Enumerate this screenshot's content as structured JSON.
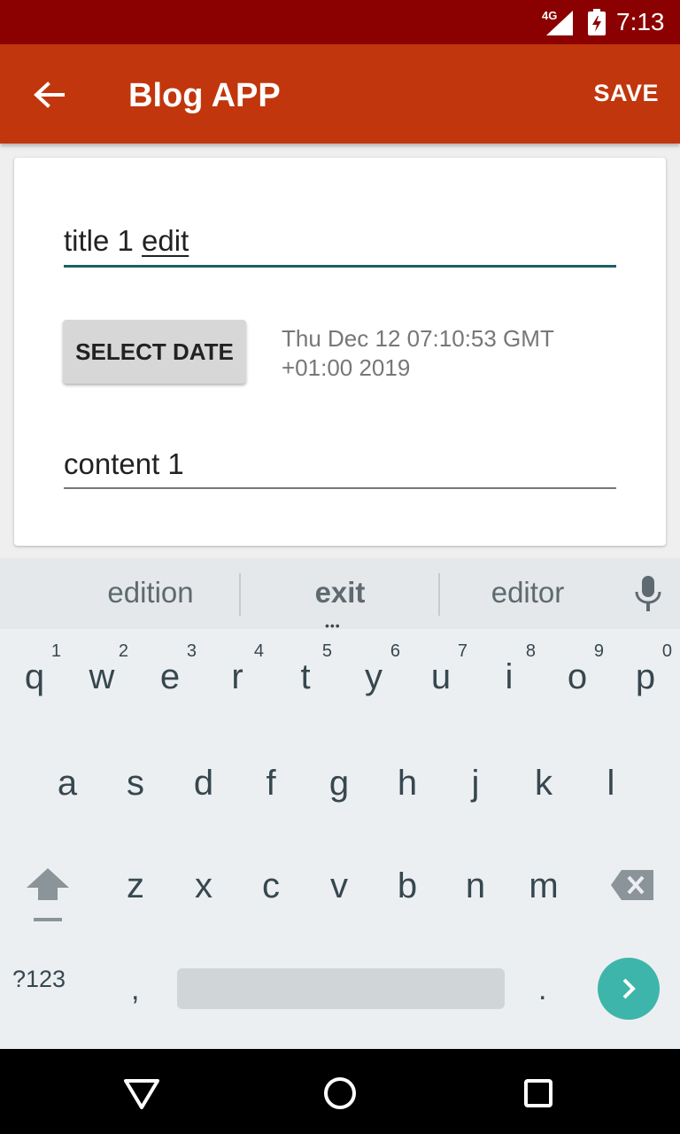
{
  "status_bar": {
    "network": "4G",
    "time": "7:13",
    "icons": [
      "signal-icon",
      "battery-charging-icon"
    ]
  },
  "toolbar": {
    "back_icon": "arrow-left-icon",
    "title": "Blog APP",
    "save_label": "SAVE"
  },
  "form": {
    "title_value_plain": "title 1 ",
    "title_value_composing": "edit",
    "select_date_label": "SELECT DATE",
    "date_line1": "Thu Dec 12 07:10:53 GMT",
    "date_line2": "+01:00 2019",
    "content_value": "content 1"
  },
  "keyboard": {
    "suggestions": [
      "edition",
      "exit",
      "editor"
    ],
    "mic_icon": "microphone-icon",
    "row1": [
      {
        "key": "q",
        "hint": "1"
      },
      {
        "key": "w",
        "hint": "2"
      },
      {
        "key": "e",
        "hint": "3"
      },
      {
        "key": "r",
        "hint": "4"
      },
      {
        "key": "t",
        "hint": "5"
      },
      {
        "key": "y",
        "hint": "6"
      },
      {
        "key": "u",
        "hint": "7"
      },
      {
        "key": "i",
        "hint": "8"
      },
      {
        "key": "o",
        "hint": "9"
      },
      {
        "key": "p",
        "hint": "0"
      }
    ],
    "row2": [
      "a",
      "s",
      "d",
      "f",
      "g",
      "h",
      "j",
      "k",
      "l"
    ],
    "row3": [
      "z",
      "x",
      "c",
      "v",
      "b",
      "n",
      "m"
    ],
    "symbols_label": "?123",
    "comma": ",",
    "period": ".",
    "shift_icon": "shift-icon",
    "backspace_icon": "backspace-icon",
    "enter_icon": "chevron-right-icon",
    "accent_color": "#3eb5aa"
  },
  "nav_bar": {
    "icons": [
      "back-triangle-icon",
      "home-circle-icon",
      "recents-square-icon"
    ]
  },
  "colors": {
    "status_bar": "#8b0000",
    "toolbar": "#c1360d",
    "title_underline": "#1d5f66"
  }
}
